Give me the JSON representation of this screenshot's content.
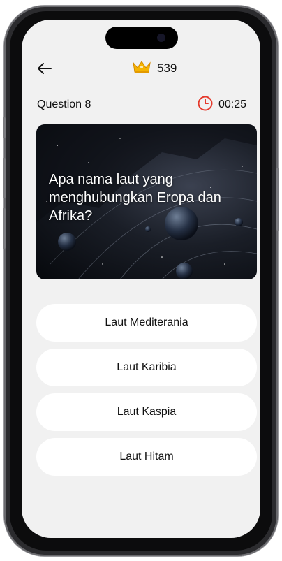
{
  "header": {
    "back_icon": "back-arrow-icon",
    "score_icon": "crown-icon",
    "score": "539"
  },
  "question": {
    "label": "Question 8",
    "timer_icon": "clock-icon",
    "timer": "00:25",
    "text": "Apa nama laut yang menghubungkan Eropa dan Afrika?",
    "image": "space-planets-background"
  },
  "answers": [
    {
      "label": "Laut Mediterania"
    },
    {
      "label": "Laut Karibia"
    },
    {
      "label": "Laut Kaspia"
    },
    {
      "label": "Laut Hitam"
    }
  ],
  "colors": {
    "screen_bg": "#f1f1f1",
    "answer_bg": "#ffffff",
    "accent_crown": "#f5b400",
    "timer_red": "#e5392b"
  }
}
